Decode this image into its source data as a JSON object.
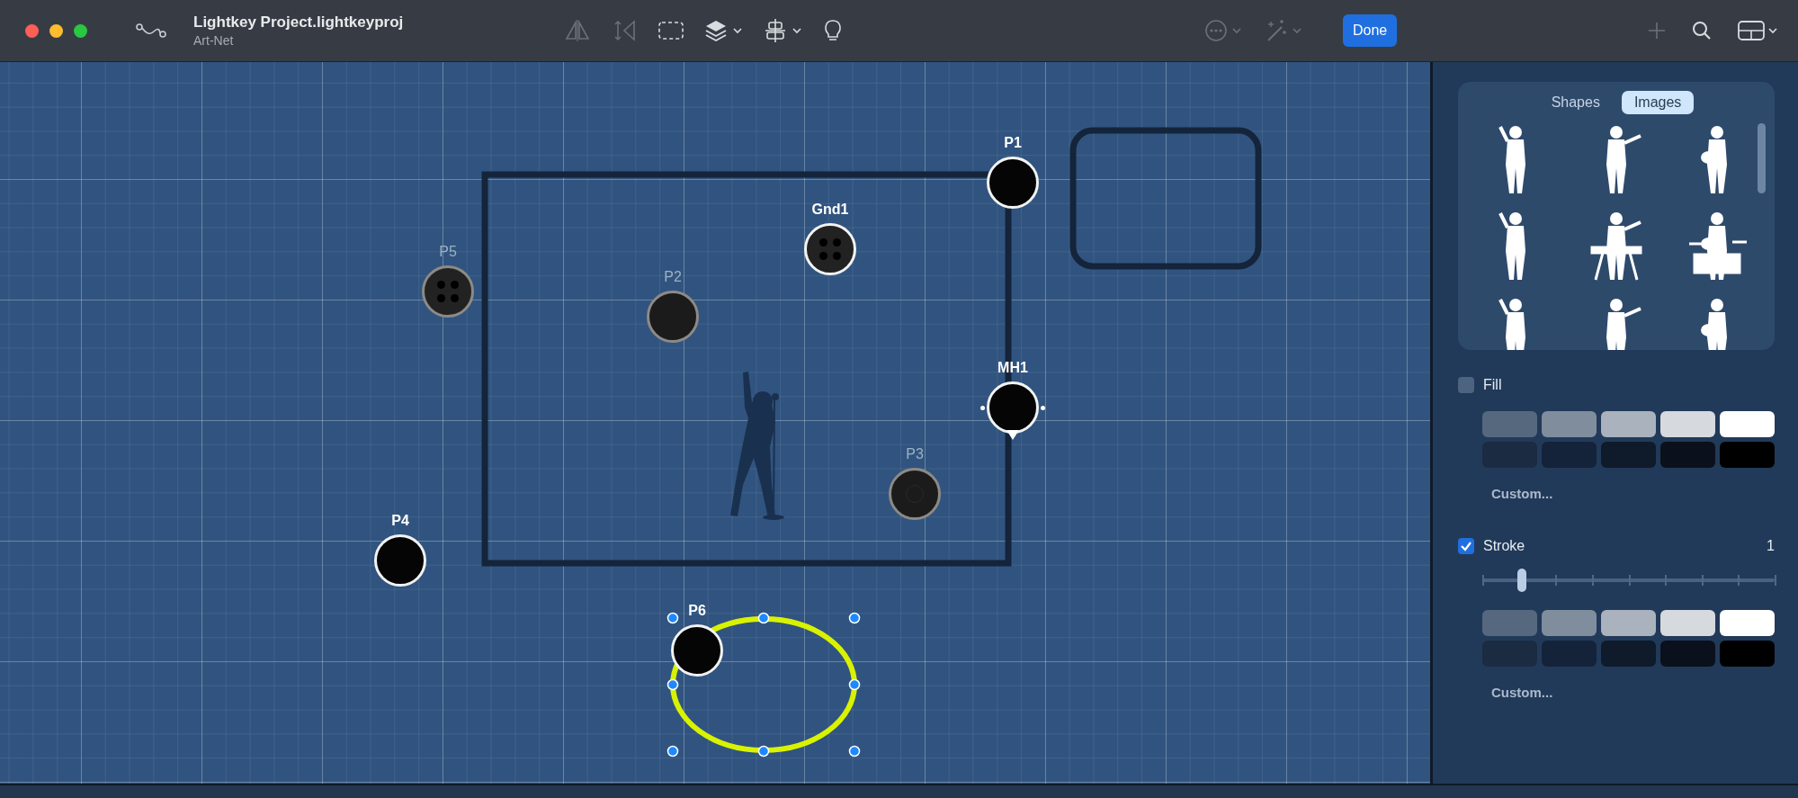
{
  "window": {
    "title": "Lightkey Project.lightkeyproj",
    "subtitle": "Art-Net"
  },
  "toolbar": {
    "tools": [
      {
        "kind": "flip-horizontal",
        "disabled": true
      },
      {
        "kind": "flip-vertical",
        "disabled": true
      },
      {
        "kind": "marquee",
        "disabled": false
      },
      {
        "kind": "layers",
        "disabled": false
      },
      {
        "kind": "align",
        "disabled": false
      },
      {
        "kind": "bulb",
        "disabled": false
      },
      {
        "kind": "more",
        "disabled": true
      },
      {
        "kind": "magic",
        "disabled": true
      }
    ],
    "done_button": "Done",
    "trailing_tools": [
      {
        "kind": "plus",
        "disabled": true
      },
      {
        "kind": "search",
        "disabled": false
      },
      {
        "kind": "layout",
        "disabled": false
      }
    ]
  },
  "canvas": {
    "fixtures": [
      {
        "label": "P1",
        "kind": "plain",
        "dimmed": false
      },
      {
        "label": "Gnd1",
        "kind": "four-dot",
        "dimmed": false
      },
      {
        "label": "P5",
        "kind": "four-dot",
        "dimmed": true
      },
      {
        "label": "P2",
        "kind": "plain",
        "dimmed": true
      },
      {
        "label": "MH1",
        "kind": "moving-head",
        "dimmed": false
      },
      {
        "label": "P3",
        "kind": "ring",
        "dimmed": true
      },
      {
        "label": "P4",
        "kind": "plain",
        "dimmed": false
      },
      {
        "label": "P6",
        "kind": "plain",
        "dimmed": false
      }
    ],
    "shapes": [
      {
        "kind": "rectangle",
        "selected": false
      },
      {
        "kind": "rounded-rectangle",
        "selected": false
      },
      {
        "kind": "ellipse",
        "selected": true
      }
    ]
  },
  "panel": {
    "tabs": [
      {
        "label": "Shapes",
        "selected": false
      },
      {
        "label": "Images",
        "selected": true
      }
    ],
    "fill": {
      "label": "Fill",
      "checked": false,
      "custom_label": "Custom...",
      "swatches": [
        {
          "color": "#56687e"
        },
        {
          "color": "#808d9d"
        },
        {
          "color": "#a9b2bd"
        },
        {
          "color": "#d6d9de"
        },
        {
          "color": "#ffffff"
        },
        {
          "color": "#1b2b42"
        },
        {
          "color": "#15233a"
        },
        {
          "color": "#0f1a2a"
        },
        {
          "color": "#0a111c"
        },
        {
          "color": "#000000"
        }
      ]
    },
    "stroke": {
      "label": "Stroke",
      "checked": true,
      "value": "1",
      "level": 0.135,
      "custom_label": "Custom...",
      "swatches": [
        {
          "color": "#56687e"
        },
        {
          "color": "#808d9d"
        },
        {
          "color": "#a9b2bd"
        },
        {
          "color": "#d6d9de"
        },
        {
          "color": "#ffffff"
        },
        {
          "color": "#1b2b42"
        },
        {
          "color": "#15233a"
        },
        {
          "color": "#0f1a2a"
        },
        {
          "color": "#0a111c"
        },
        {
          "color": "#000000"
        }
      ]
    }
  }
}
